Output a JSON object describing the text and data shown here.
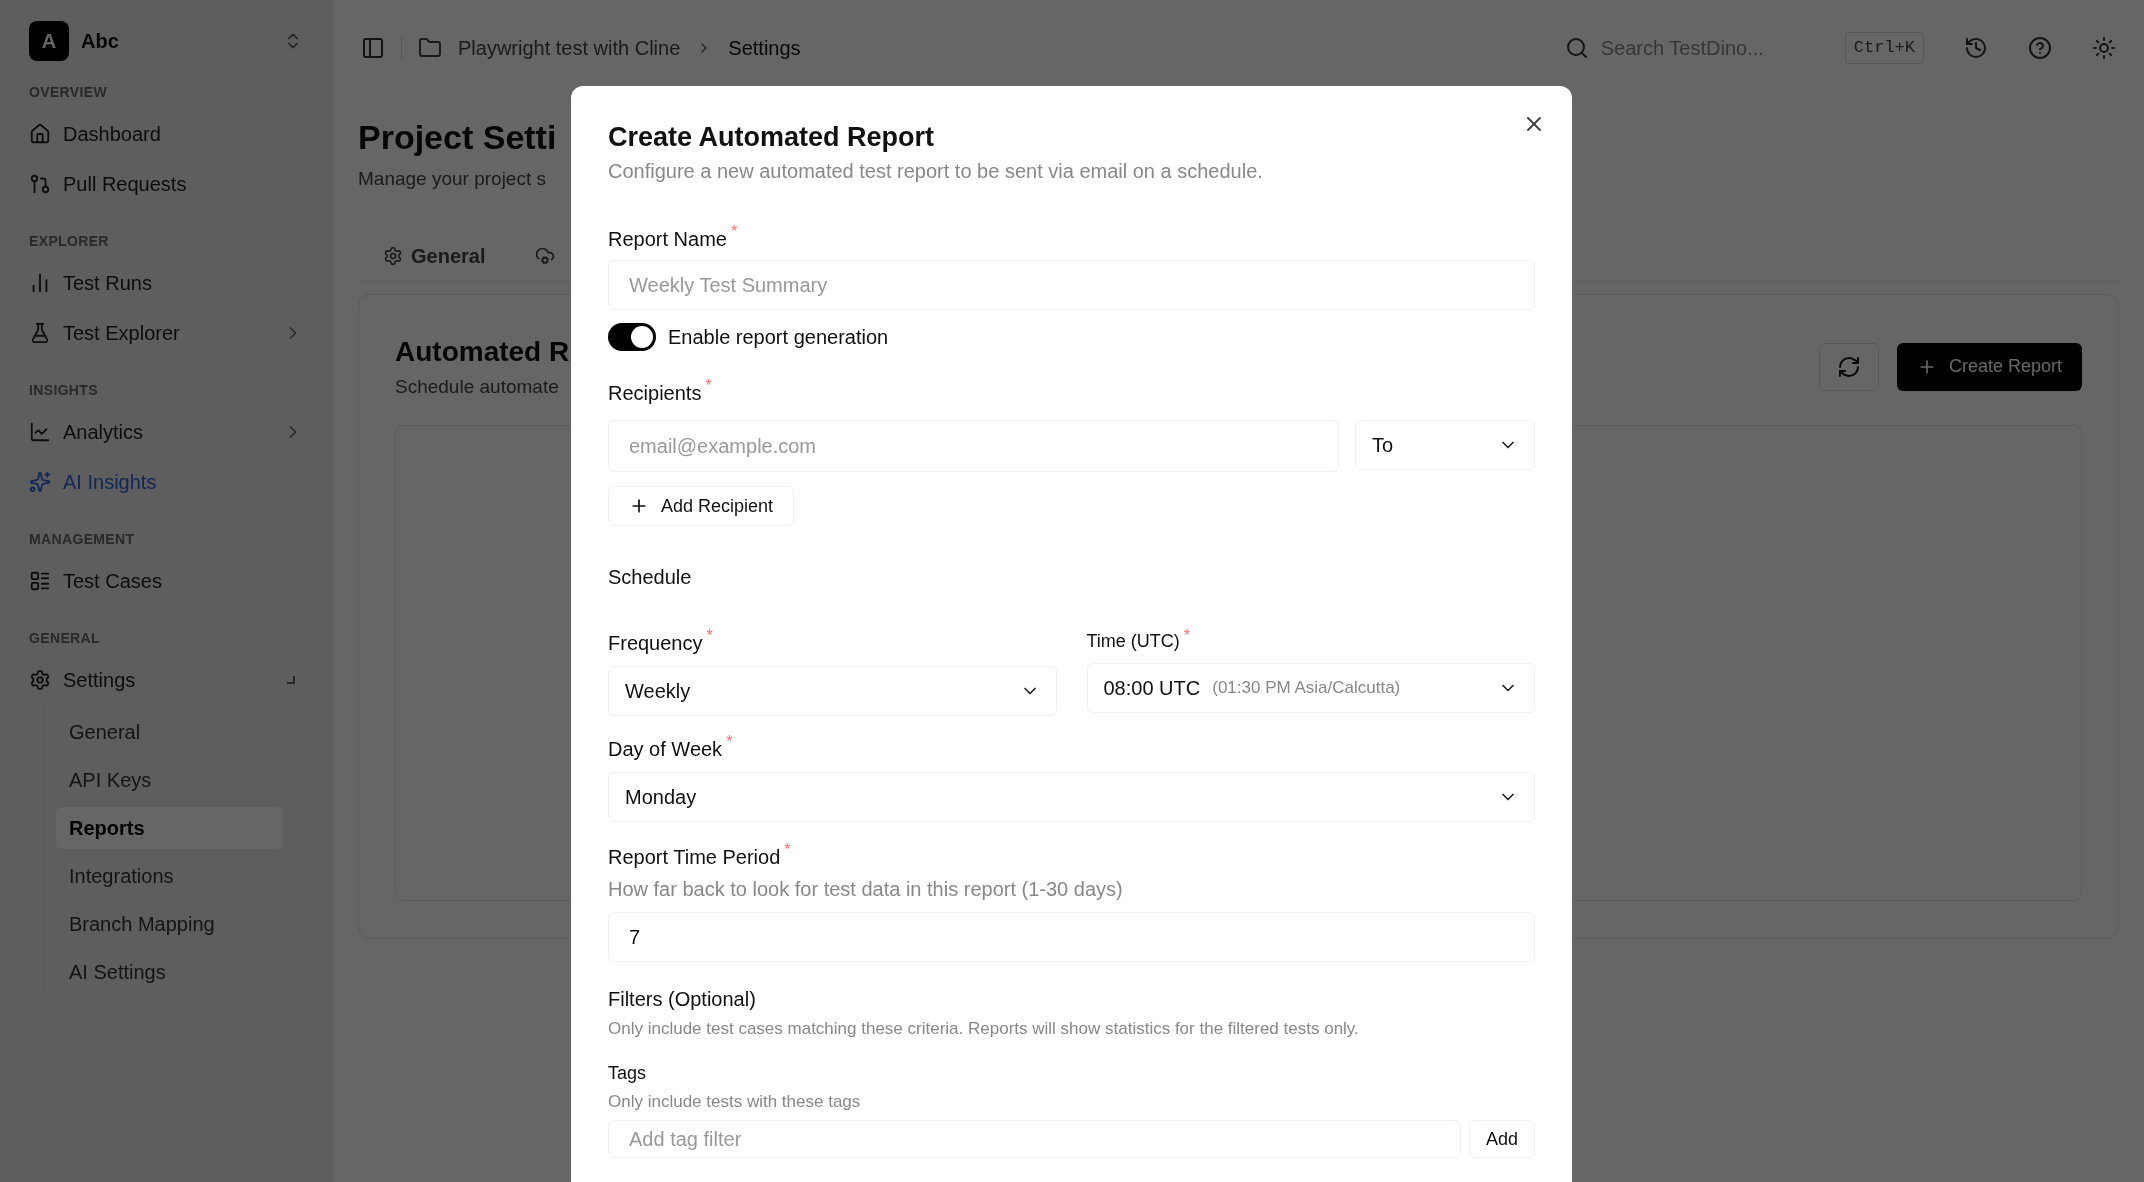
{
  "workspace": {
    "avatar": "A",
    "name": "Abc"
  },
  "sidebar": {
    "sections": [
      {
        "title": "OVERVIEW",
        "items": [
          {
            "label": "Dashboard",
            "accent": false,
            "expandable": false
          },
          {
            "label": "Pull Requests",
            "accent": false,
            "expandable": false
          }
        ]
      },
      {
        "title": "EXPLORER",
        "items": [
          {
            "label": "Test Runs",
            "accent": false,
            "expandable": false
          },
          {
            "label": "Test Explorer",
            "accent": false,
            "expandable": true,
            "expanded": false
          }
        ]
      },
      {
        "title": "INSIGHTS",
        "items": [
          {
            "label": "Analytics",
            "accent": false,
            "expandable": true,
            "expanded": false
          },
          {
            "label": "AI Insights",
            "accent": true,
            "expandable": false
          }
        ]
      },
      {
        "title": "MANAGEMENT",
        "items": [
          {
            "label": "Test Cases",
            "accent": false,
            "expandable": false
          }
        ]
      },
      {
        "title": "GENERAL",
        "items": [
          {
            "label": "Settings",
            "accent": false,
            "expandable": true,
            "expanded": true,
            "children": [
              {
                "label": "General",
                "selected": false
              },
              {
                "label": "API Keys",
                "selected": false
              },
              {
                "label": "Reports",
                "selected": true
              },
              {
                "label": "Integrations",
                "selected": false
              },
              {
                "label": "Branch Mapping",
                "selected": false
              },
              {
                "label": "AI Settings",
                "selected": false
              }
            ]
          }
        ]
      }
    ]
  },
  "topbar": {
    "breadcrumb": [
      "Playwright test with Cline",
      "Settings"
    ],
    "search": {
      "placeholder": "Search TestDino..."
    },
    "shortcut": "Ctrl+K"
  },
  "page": {
    "title": "Project Setti",
    "subtitle": "Manage your project s",
    "tabs": [
      {
        "label": "General",
        "selected": false
      }
    ],
    "card": {
      "title": "Automated R",
      "subtitle": "Schedule automate",
      "create_button": "Create Report"
    }
  },
  "dialog": {
    "title": "Create Automated Report",
    "description": "Configure a new automated test report to be sent via email on a schedule.",
    "report_name": {
      "label": "Report Name",
      "mark": "*",
      "placeholder": "Weekly Test Summary"
    },
    "enable_toggle": {
      "label": "Enable report generation",
      "on": true
    },
    "recipients": {
      "label": "Recipients",
      "mark": "*",
      "placeholder": "email@example.com",
      "type": "To",
      "add_button": "Add Recipient"
    },
    "schedule_heading": "Schedule",
    "frequency": {
      "label": "Frequency",
      "mark": "*",
      "value": "Weekly"
    },
    "time": {
      "label": "Time (UTC)",
      "mark": "*",
      "value": "08:00 UTC",
      "local": "(01:30 PM Asia/Calcutta)"
    },
    "day_of_week": {
      "label": "Day of Week",
      "mark": "*",
      "value": "Monday"
    },
    "time_period": {
      "label": "Report Time Period",
      "mark": "*",
      "hint": "How far back to look for test data in this report (1-30 days)",
      "value": "7"
    },
    "filters": {
      "heading": "Filters (Optional)",
      "description": "Only include test cases matching these criteria. Reports will show statistics for the filtered tests only.",
      "tags": {
        "label": "Tags",
        "hint": "Only include tests with these tags",
        "placeholder": "Add tag filter",
        "add_button": "Add"
      }
    }
  }
}
